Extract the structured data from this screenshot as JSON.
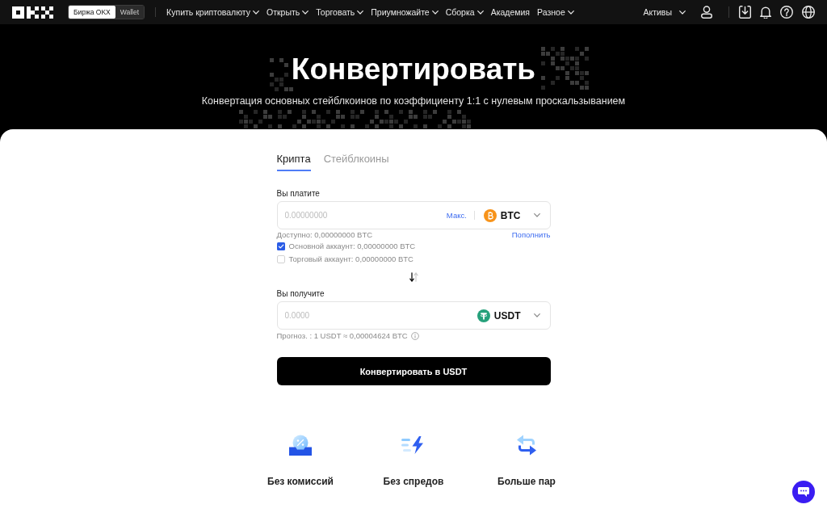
{
  "header": {
    "platform_switch": [
      {
        "label": "Биржа OKX",
        "selected": true
      },
      {
        "label": "Wallet",
        "selected": false
      }
    ],
    "nav_items": [
      {
        "label": "Купить криптовалюту",
        "dropdown": true
      },
      {
        "label": "Открыть",
        "dropdown": true
      },
      {
        "label": "Торговать",
        "dropdown": true
      },
      {
        "label": "Приумножайте",
        "dropdown": true
      },
      {
        "label": "Сборка",
        "dropdown": true
      },
      {
        "label": "Академия",
        "dropdown": false
      },
      {
        "label": "Разное",
        "dropdown": true
      }
    ],
    "assets_menu": {
      "label": "Активы",
      "dropdown": true
    }
  },
  "hero": {
    "title": "Конвертировать",
    "subtitle": "Конвертация основных стейблкоинов по коэффициенту 1:1 с нулевым проскальзыванием"
  },
  "converter": {
    "tabs": [
      {
        "label": "Крипта",
        "selected": true
      },
      {
        "label": "Стейблкоины",
        "selected": false
      }
    ],
    "pay": {
      "label": "Вы платите",
      "placeholder": "0.00000000",
      "max_link": "Макс.",
      "coin": {
        "symbol": "BTC",
        "kind": "bitcoin"
      }
    },
    "available": {
      "text": "Доступно: 0,00000000 BTC",
      "deposit_link": "Пополнить"
    },
    "accounts": [
      {
        "label": "Основной аккаунт: 0,00000000 BTC",
        "checked": true
      },
      {
        "label": "Торговый аккаунт: 0,00000000 BTC",
        "checked": false
      }
    ],
    "receive": {
      "label": "Вы получите",
      "placeholder": "0.0000",
      "coin": {
        "symbol": "USDT",
        "kind": "tether"
      }
    },
    "estimate": "Прогноз. : 1 USDT ≈ 0,00004624 BTC",
    "submit": "Конвертировать в USDT"
  },
  "features": [
    {
      "label": "Без комиссий",
      "kind": "fee"
    },
    {
      "label": "Без спредов",
      "kind": "spread"
    },
    {
      "label": "Больше пар",
      "kind": "pairs"
    }
  ]
}
